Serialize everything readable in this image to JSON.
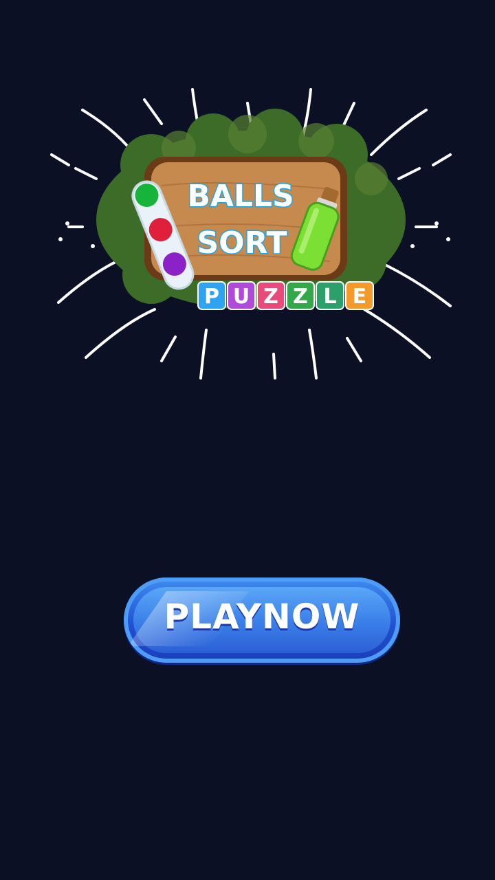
{
  "logo": {
    "line1": "BALLS",
    "line2": "SORT",
    "tiles": [
      {
        "letter": "P",
        "color": "#2ea4f0"
      },
      {
        "letter": "U",
        "color": "#b04ad8"
      },
      {
        "letter": "Z",
        "color": "#e84a7a"
      },
      {
        "letter": "Z",
        "color": "#33a84a"
      },
      {
        "letter": "L",
        "color": "#2ba06a"
      },
      {
        "letter": "E",
        "color": "#f39a2a"
      }
    ],
    "ball_colors": [
      "#16b43a",
      "#e0203a",
      "#8a22c8"
    ],
    "bottle_color": "#7be033"
  },
  "play_button": {
    "label": "PLAYNOW"
  }
}
